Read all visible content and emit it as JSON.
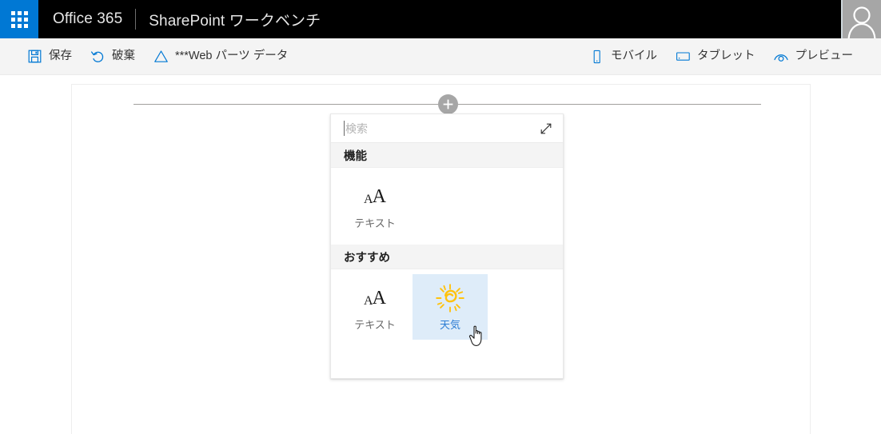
{
  "suite_bar": {
    "waffle_icon": "waffle-grid-icon",
    "brand": "Office 365",
    "title": "SharePoint ワークベンチ",
    "account_icon": "person-avatar-icon"
  },
  "command_bar": {
    "left_items": [
      {
        "icon": "save-floppy-icon",
        "label": "保存"
      },
      {
        "icon": "undo-arrow-icon",
        "label": "破棄"
      },
      {
        "icon": "triangle-outline-icon",
        "label": "***Web パーツ データ"
      }
    ],
    "right_items": [
      {
        "icon": "mobile-phone-icon",
        "label": "モバイル"
      },
      {
        "icon": "tablet-icon",
        "label": "タブレット"
      },
      {
        "icon": "preview-eye-icon",
        "label": "プレビュー"
      }
    ]
  },
  "canvas": {
    "add_button_icon": "plus-icon",
    "add_button_label": "+"
  },
  "picker": {
    "search": {
      "placeholder": "検索",
      "value": "",
      "expand_icon": "expand-diagonal-arrows-icon"
    },
    "sections": [
      {
        "header": "機能",
        "tiles": [
          {
            "icon": "text-aa-icon",
            "label": "テキスト",
            "selected": false
          }
        ]
      },
      {
        "header": "おすすめ",
        "tiles": [
          {
            "icon": "text-aa-icon",
            "label": "テキスト",
            "selected": false
          },
          {
            "icon": "weather-sun-icon",
            "label": "天気",
            "selected": true
          }
        ]
      }
    ]
  },
  "cursor": {
    "icon": "pointing-hand-cursor"
  },
  "colors": {
    "suite_bar_bg": "#000000",
    "waffle_blue": "#0078d4",
    "command_bar_bg": "#f4f4f4",
    "accent_blue": "#0078d4",
    "selected_tile_bg": "#deecf9",
    "selected_tile_text": "#2b7cd3",
    "sun_yellow": "#ffc20e",
    "section_header_bg": "#f4f4f4",
    "avatar_bg": "#a6a6a6"
  }
}
